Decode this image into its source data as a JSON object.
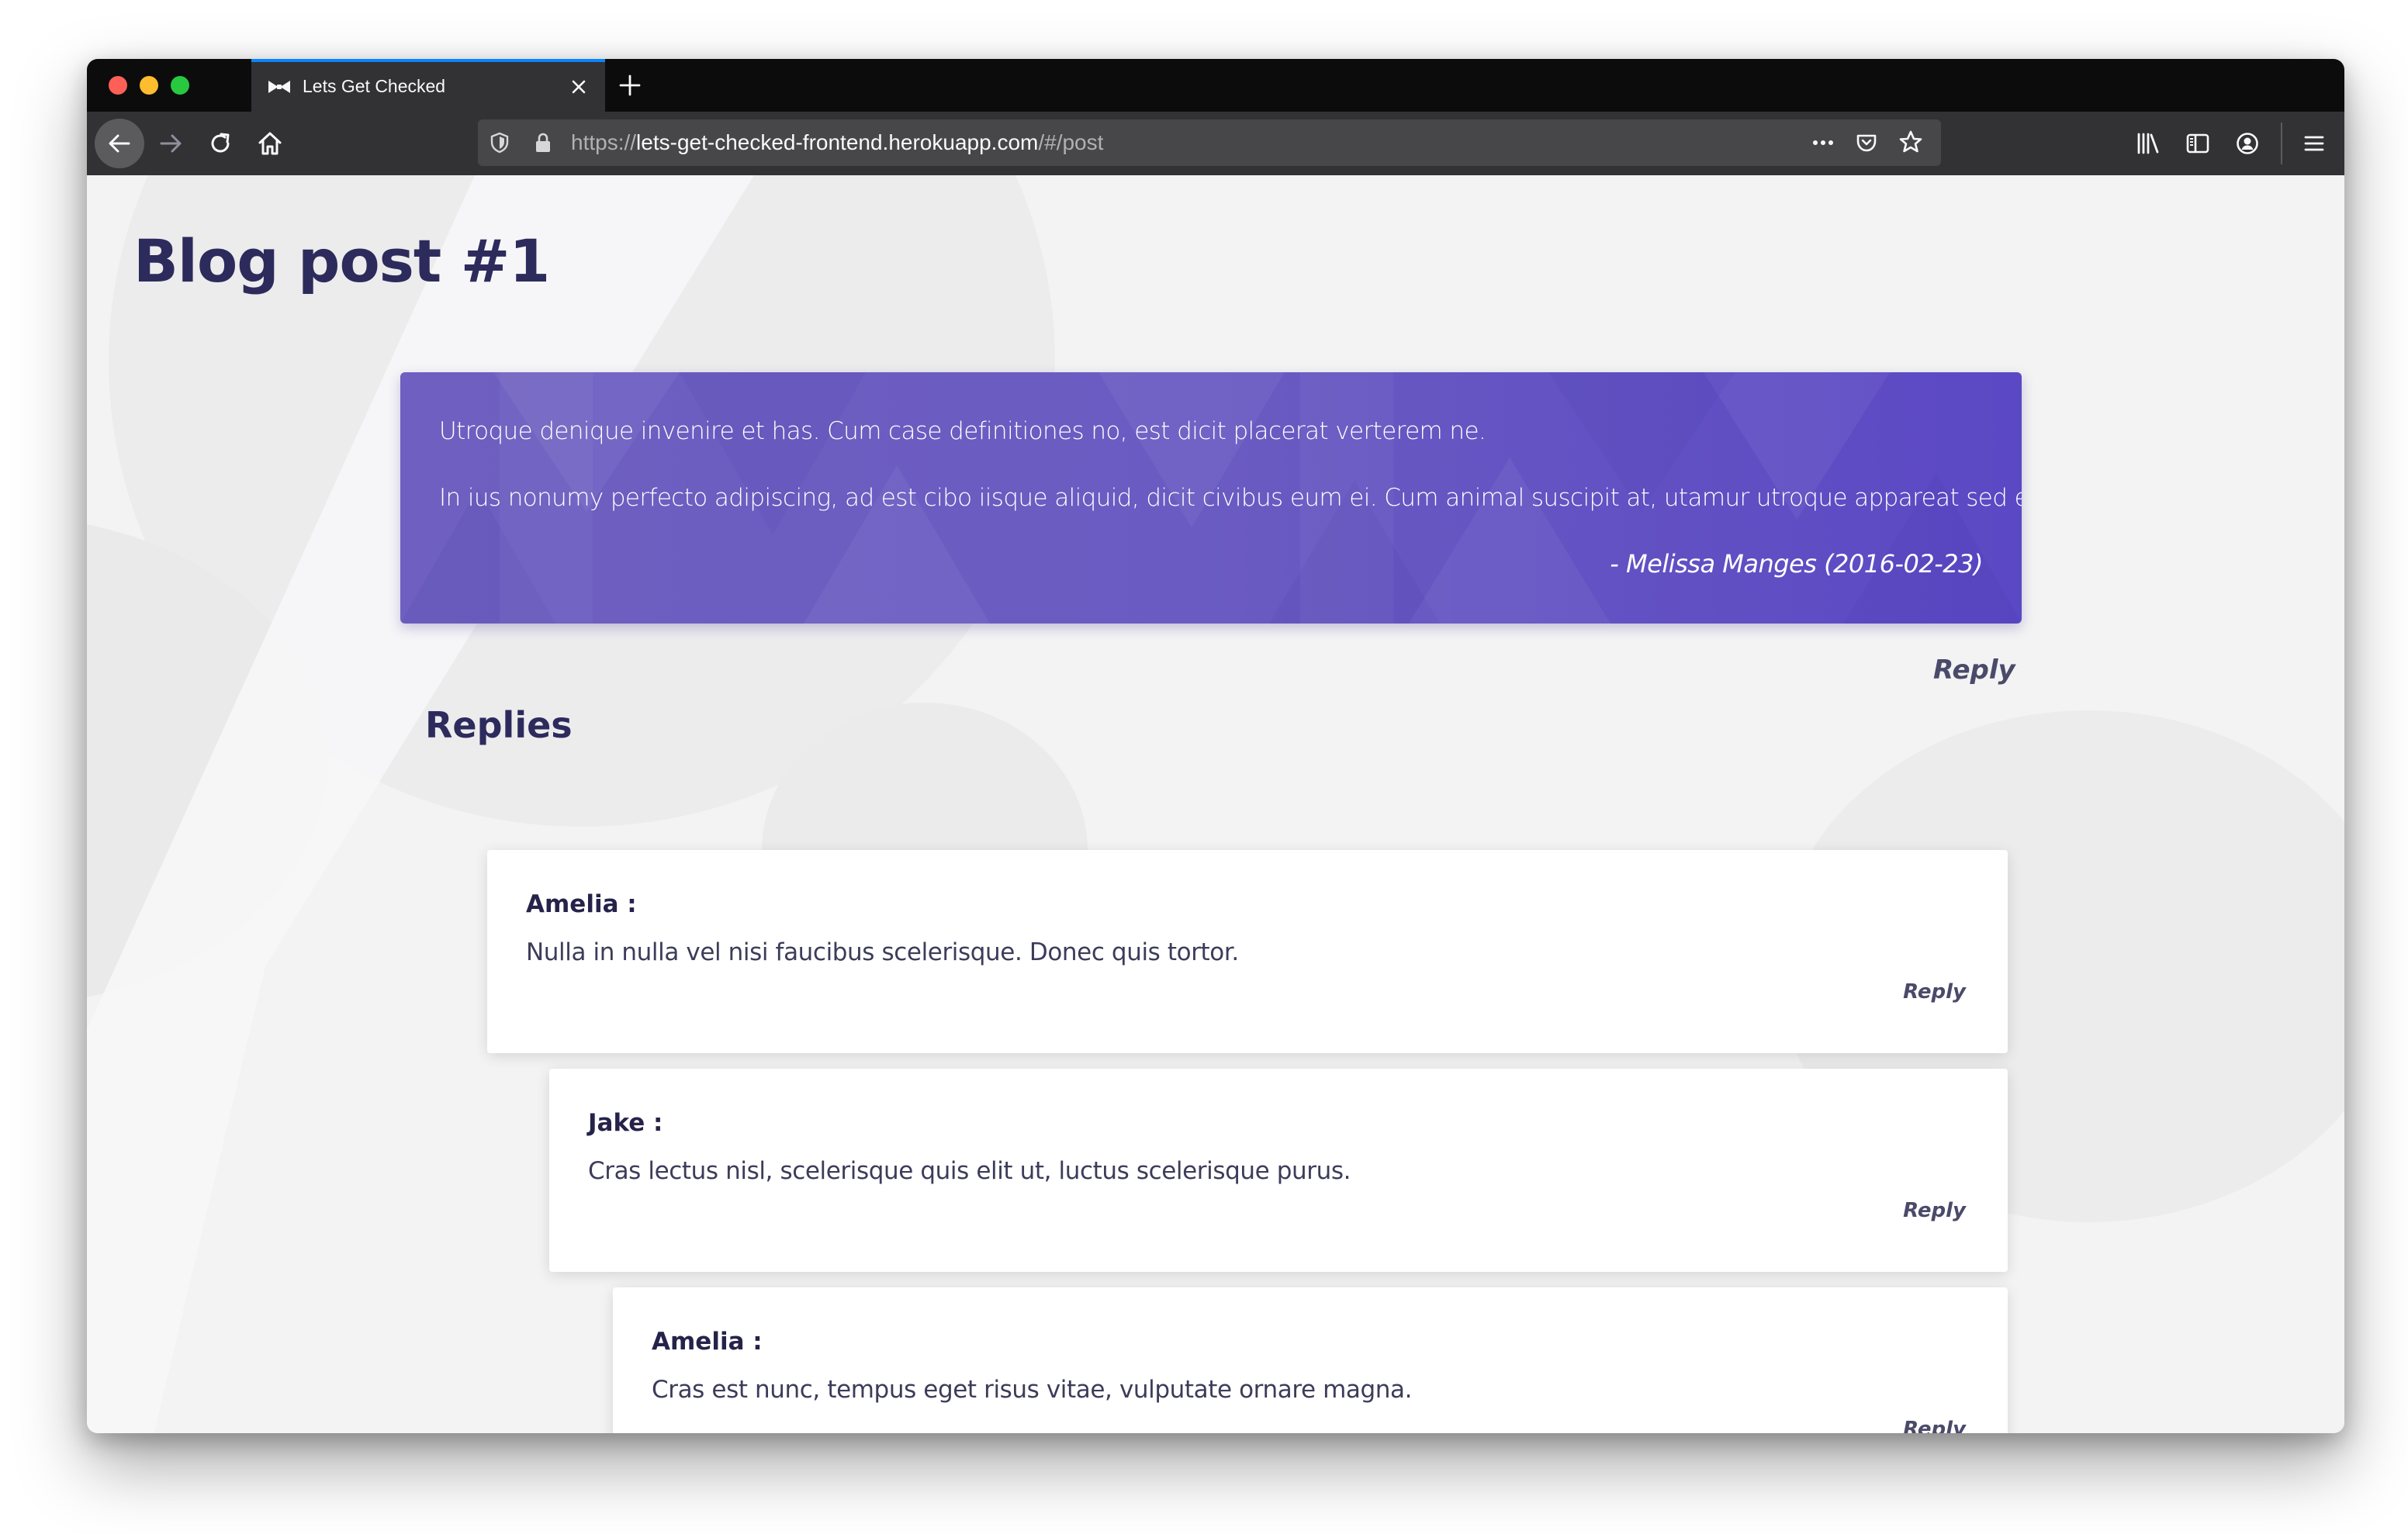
{
  "browser": {
    "tab": {
      "title": "Lets Get Checked"
    },
    "url": {
      "scheme": "https://",
      "host": "lets-get-checked-frontend.herokuapp.com",
      "path": "/#/post"
    },
    "icons": {
      "favicon": "bowtie-icon",
      "close": "close-icon",
      "new_tab": "plus-icon",
      "back": "arrow-left-icon",
      "forward": "arrow-right-icon",
      "reload": "reload-icon",
      "home": "home-icon",
      "tracking": "shield-icon",
      "secure": "lock-icon",
      "page_actions": "more-dots-icon",
      "pocket": "pocket-icon",
      "bookmark": "star-icon",
      "library": "library-icon",
      "sidebar": "sidebar-icon",
      "account": "account-icon",
      "menu": "hamburger-menu-icon"
    }
  },
  "page": {
    "title": "Blog post #1",
    "post": {
      "paragraphs": [
        "Utroque denique invenire et has. Cum case definitiones no, est dicit placerat verterem ne.",
        "In ius nonumy perfecto adipiscing, ad est cibo iisque aliquid, dicit civibus eum ei. Cum animal suscipit at, utamur utroque appareat sed ex."
      ],
      "author_line": "- Melissa Manges (2016-02-23)",
      "reply_label": "Reply"
    },
    "replies_heading": "Replies",
    "replies": [
      {
        "author": "Amelia :",
        "text": "Nulla in nulla vel nisi faucibus scelerisque. Donec quis tortor.",
        "reply_label": "Reply"
      },
      {
        "author": "Jake :",
        "text": "Cras lectus nisl, scelerisque quis elit ut, luctus scelerisque purus.",
        "reply_label": "Reply"
      },
      {
        "author": "Amelia :",
        "text": "Cras est nunc, tempus eget risus vitae, vulputate ornare magna.",
        "reply_label": "Reply"
      }
    ]
  },
  "colors": {
    "title": "#2d2b5c",
    "post_gradient_start": "#6e5fc0",
    "post_gradient_end": "#5b48c4",
    "tab_accent": "#0a84ff",
    "link": "#4a4a6a"
  }
}
